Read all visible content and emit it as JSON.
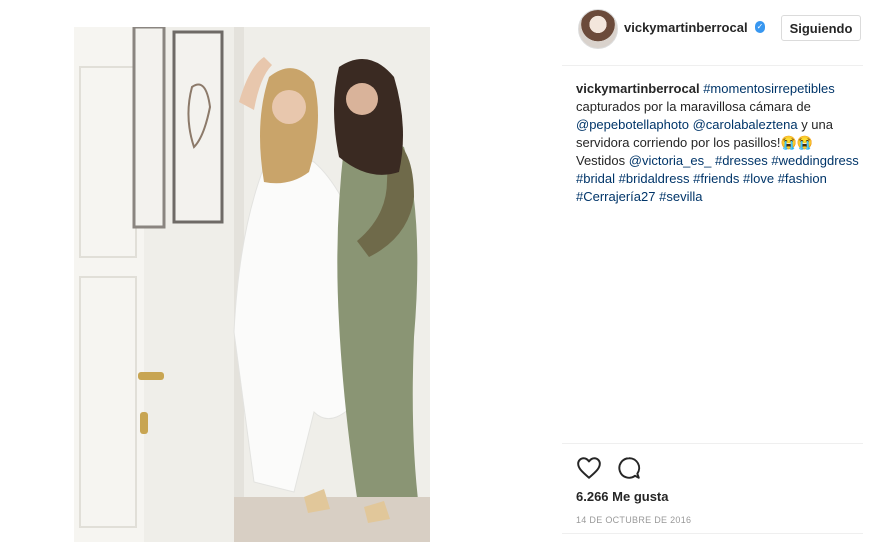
{
  "header": {
    "username": "vickymartinberrocal",
    "verified_mark": "✓",
    "follow_label": "Siguiendo"
  },
  "caption": {
    "author": "vickymartinberrocal",
    "segments": [
      {
        "type": "tag",
        "text": "#momentosirrepetibles"
      },
      {
        "type": "text",
        "text": " capturados por la maravillosa cámara de "
      },
      {
        "type": "mention",
        "text": "@pepebotellaphoto"
      },
      {
        "type": "text",
        "text": " "
      },
      {
        "type": "mention",
        "text": "@carolabaleztena"
      },
      {
        "type": "text",
        "text": " y una servidora corriendo por los pasillos!😭😭 Vestidos "
      },
      {
        "type": "mention",
        "text": "@victoria_es_"
      },
      {
        "type": "text",
        "text": " "
      },
      {
        "type": "tag",
        "text": "#dresses"
      },
      {
        "type": "text",
        "text": " "
      },
      {
        "type": "tag",
        "text": "#weddingdress"
      },
      {
        "type": "text",
        "text": " "
      },
      {
        "type": "tag",
        "text": "#bridal"
      },
      {
        "type": "text",
        "text": " "
      },
      {
        "type": "tag",
        "text": "#bridaldress"
      },
      {
        "type": "text",
        "text": " "
      },
      {
        "type": "tag",
        "text": "#friends"
      },
      {
        "type": "text",
        "text": " "
      },
      {
        "type": "tag",
        "text": "#love"
      },
      {
        "type": "text",
        "text": " "
      },
      {
        "type": "tag",
        "text": "#fashion"
      },
      {
        "type": "text",
        "text": " "
      },
      {
        "type": "tag",
        "text": "#Cerrajería27"
      },
      {
        "type": "text",
        "text": " "
      },
      {
        "type": "tag",
        "text": "#sevilla"
      }
    ]
  },
  "actions": {
    "like_icon": "heart-icon",
    "comment_icon": "comment-icon"
  },
  "likes": "6.266 Me gusta",
  "date": "14 DE OCTUBRE DE 2016"
}
